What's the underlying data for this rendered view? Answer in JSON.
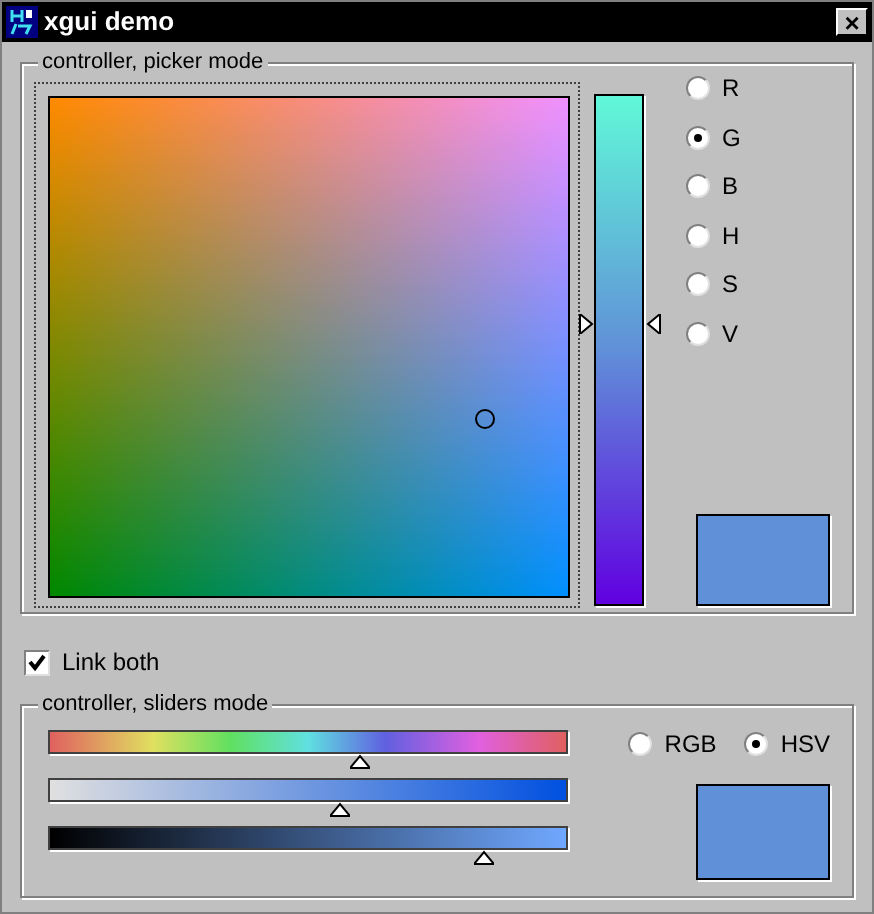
{
  "window": {
    "title": "xgui demo",
    "close": "×"
  },
  "picker_group": {
    "title": "controller, picker mode",
    "channel_slider": {
      "level": 0.55
    },
    "channels": [
      {
        "label": "R",
        "selected": false
      },
      {
        "label": "G",
        "selected": true
      },
      {
        "label": "B",
        "selected": false
      },
      {
        "label": "H",
        "selected": false
      },
      {
        "label": "S",
        "selected": false
      },
      {
        "label": "V",
        "selected": false
      }
    ]
  },
  "link_both": {
    "label": "Link both",
    "checked": true
  },
  "sliders_group": {
    "title": "controller, sliders mode",
    "sliders": [
      {
        "kind": "hue",
        "level": 0.6
      },
      {
        "kind": "saturation",
        "level": 0.56
      },
      {
        "kind": "value",
        "level": 0.84
      }
    ],
    "modes": [
      {
        "label": "RGB",
        "selected": false
      },
      {
        "label": "HSV",
        "selected": true
      }
    ]
  }
}
